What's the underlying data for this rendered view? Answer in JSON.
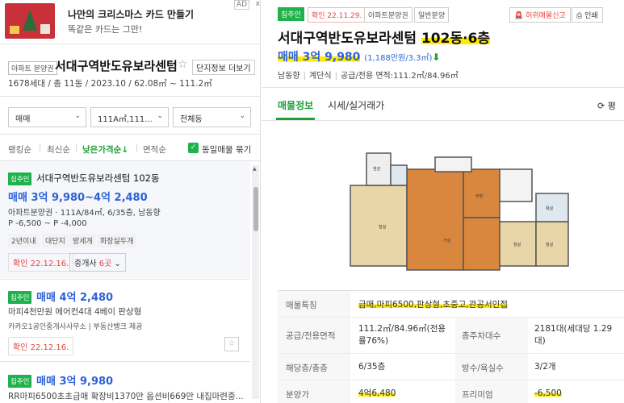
{
  "ad": {
    "title": "나만의 크리스마스 카드 만들기",
    "subtitle": "똑같은 카드는 그만!",
    "badge": "AD",
    "close": "x"
  },
  "complex": {
    "tag": "아파트 분양권",
    "name": "서대구역반도유보라센텀",
    "more": "단지정보 더보기",
    "info": "1678세대 / 총 11동 / 2023.10 / 62.08㎡ ~ 111.2㎡"
  },
  "filters": {
    "trade": "매매",
    "area": "111A㎡,111...",
    "building": "전체동"
  },
  "sort": {
    "items": [
      "랭킹순",
      "최신순",
      "낮은가격순↓",
      "면적순"
    ],
    "same_listing": "동일매물 묶기"
  },
  "listings": [
    {
      "badge": "집주인",
      "title": "서대구역반도유보라센텀 102동",
      "price": "매매 3억 9,980~4억 2,480",
      "line1": "아파트분양권 · 111A/84㎡, 6/35층, 남동향",
      "line2": "P -6,500 ~ P -4,000",
      "chips": [
        "2년이내",
        "대단지",
        "방세개",
        "화장실두개"
      ],
      "confirm": "확인 22.12.16.",
      "brokers_prefix": "중개사 ",
      "brokers_count": "6곳",
      "brokers_suffix": " ⌄"
    },
    {
      "badge": "집주인",
      "price": "매매 4억 2,480",
      "line1": "마피4천만원 에어컨4대 4베이 판상형",
      "line2": "카카오1공인중개사사무소 | 부동산뱅크 제공",
      "confirm": "확인 22.12.16."
    },
    {
      "badge": "집주인",
      "price": "매매 3억 9,980",
      "line1": "RR마피6500초초급매 확장비1370만 옵션비669만 내집마련중..."
    }
  ],
  "detail": {
    "badge": "집주인",
    "chip_confirm": "확인 22.11.29.",
    "chip_type": "아파트분양권",
    "chip_supply": "일반분양",
    "report": "허위매물신고",
    "print": "인쇄",
    "title_plain": "서대구역반도유보라센텀 ",
    "title_hl": "102동·6층",
    "price_main": "매매 3억 9,980",
    "price_unit": "(1,188만원/3.3㎡)",
    "price_arrow": "⬇",
    "meta": [
      "남동향",
      "계단식",
      "공급/전용 면적:111.2㎡/84.96㎡"
    ],
    "tabs": [
      "매물정보",
      "시세/실거래가"
    ],
    "refresh": "⟳ 평",
    "plan_labels": [
      "현관",
      "거실",
      "주방",
      "침실",
      "침실",
      "침실",
      "욕실"
    ],
    "rows": [
      {
        "k1": "매물특징",
        "v1": "급매,마피6500,판상형,초중고,관공서인접"
      },
      {
        "k1": "공급/전용면적",
        "v1": "111.2㎡/84.96㎡(전용률76%)",
        "k2": "총주차대수",
        "v2": "2181대(세대당 1.29대)"
      },
      {
        "k1": "해당층/총층",
        "v1": "6/35층",
        "k2": "방수/욕실수",
        "v2": "3/2개"
      },
      {
        "k1": "분양가",
        "v1": "4억6,480",
        "k2": "프리미엄",
        "v2": "-6,500"
      }
    ]
  },
  "colors": {
    "green": "#1fb14b",
    "blue_price": "#2d62d6",
    "red": "#e8433e",
    "highlight": "#ffea00"
  }
}
